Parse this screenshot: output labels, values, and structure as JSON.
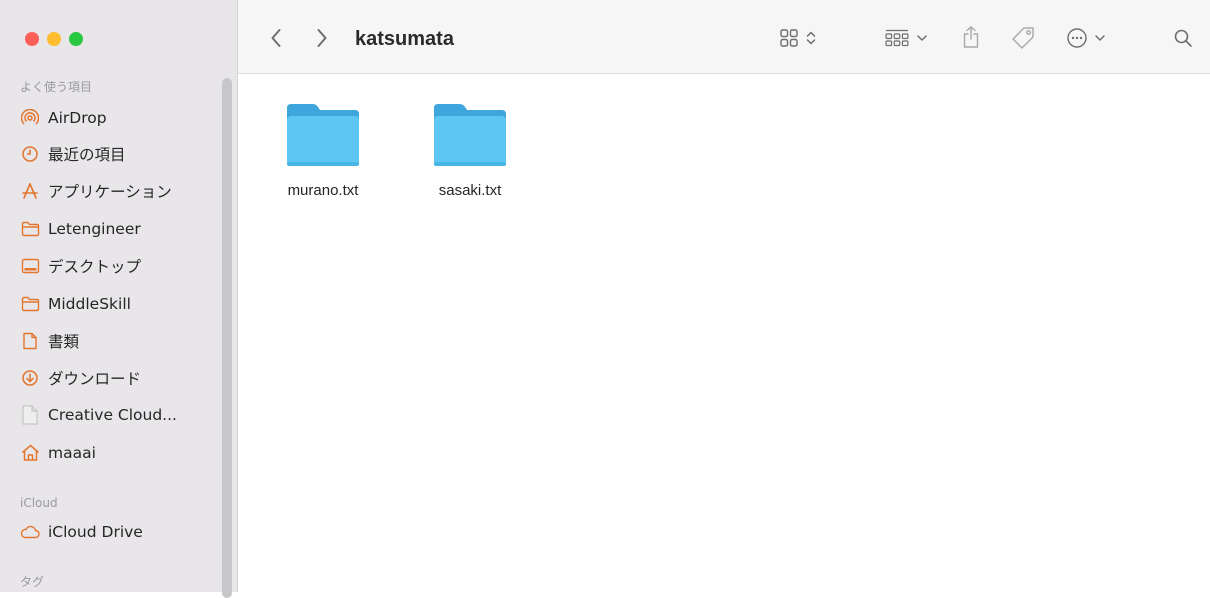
{
  "window": {
    "title": "katsumata"
  },
  "sidebar": {
    "sections": [
      {
        "label": "よく使う項目"
      },
      {
        "label": "iCloud"
      },
      {
        "label": "タグ"
      }
    ],
    "favorites": [
      {
        "label": "AirDrop",
        "icon": "airdrop-icon"
      },
      {
        "label": "最近の項目",
        "icon": "clock-icon"
      },
      {
        "label": "アプリケーション",
        "icon": "applications-icon"
      },
      {
        "label": "Letengineer",
        "icon": "folder-icon"
      },
      {
        "label": "デスクトップ",
        "icon": "desktop-icon"
      },
      {
        "label": "MiddleSkill",
        "icon": "folder-icon"
      },
      {
        "label": "書類",
        "icon": "document-icon"
      },
      {
        "label": "ダウンロード",
        "icon": "download-icon"
      },
      {
        "label": "Creative Cloud...",
        "icon": "file-icon"
      },
      {
        "label": "maaai",
        "icon": "home-icon"
      }
    ],
    "icloud": [
      {
        "label": "iCloud Drive",
        "icon": "cloud-icon"
      }
    ]
  },
  "files": [
    {
      "name": "murano.txt",
      "icon": "folder-icon"
    },
    {
      "name": "sasaki.txt",
      "icon": "folder-icon"
    }
  ],
  "colors": {
    "accent": "#e4752d",
    "folder": "#5ec6f3",
    "folder_tab": "#3ea6dc"
  }
}
